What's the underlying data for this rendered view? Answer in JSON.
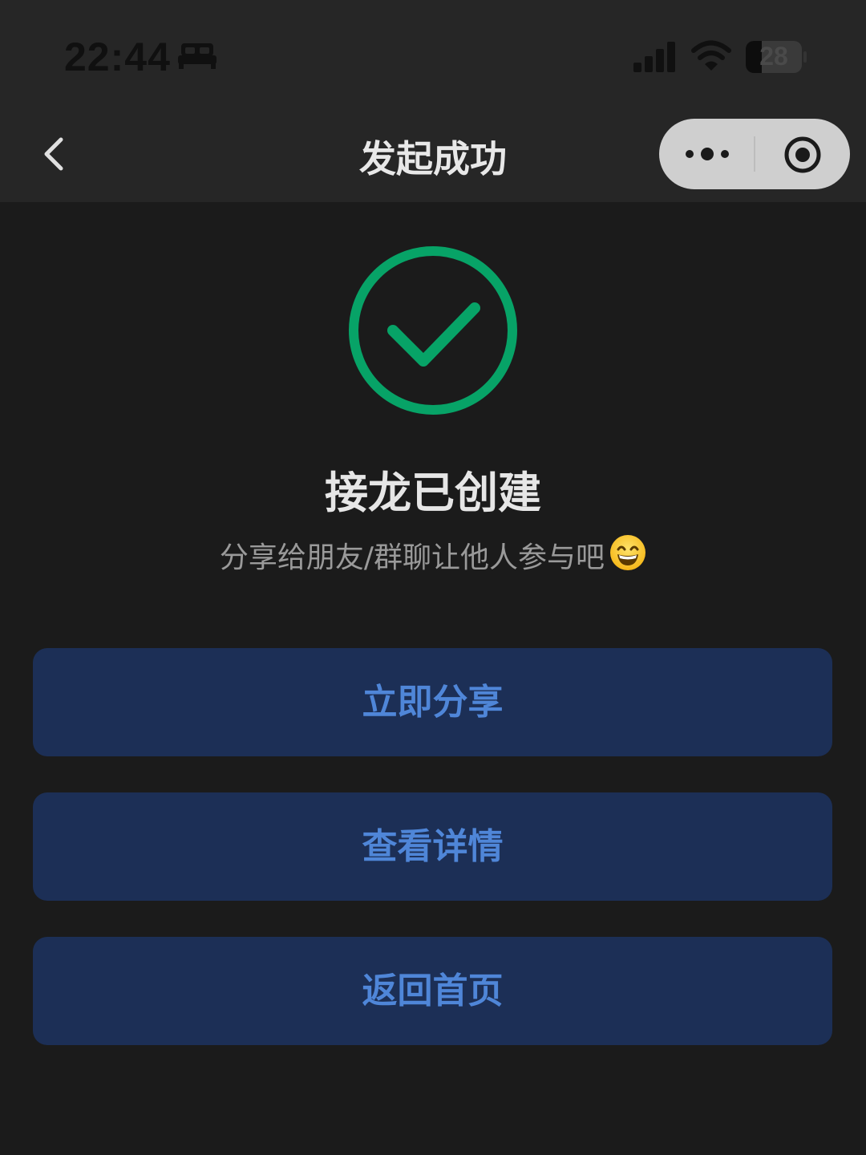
{
  "status_bar": {
    "time": "22:44",
    "battery_percent": 28,
    "battery_label": "28",
    "icons": [
      "bed-icon",
      "signal-icon",
      "wifi-icon",
      "battery-icon"
    ]
  },
  "nav": {
    "title": "发起成功",
    "back_icon": "chevron-left-icon",
    "more_icon": "more-dots-icon",
    "close_icon": "target-close-icon"
  },
  "content": {
    "success_icon": "check-circle-icon",
    "headline": "接龙已创建",
    "subline": "分享给朋友/群聊让他人参与吧",
    "emoji": "grinning-face-icon"
  },
  "buttons": {
    "share": "立即分享",
    "detail": "查看详情",
    "home": "返回首页"
  },
  "colors": {
    "background": "#1b1b1b",
    "bar": "#262626",
    "success_green": "#07a367",
    "button_bg": "#1c2f56",
    "button_text": "#4f86d8"
  }
}
